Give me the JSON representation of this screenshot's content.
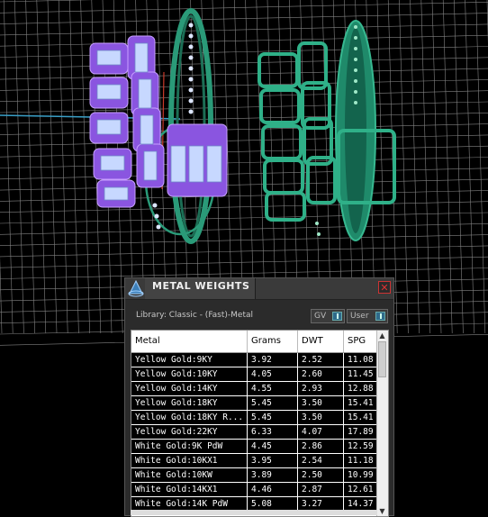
{
  "panel": {
    "title": "METAL WEIGHTS",
    "close_label": "✕",
    "library_label": "Library: Classic - (Fast)-Metal",
    "toggle_gv_label": "GV",
    "toggle_user_label": "User"
  },
  "table": {
    "columns": [
      "Metal",
      "Grams",
      "DWT",
      "SPG"
    ],
    "rows": [
      [
        "Yellow Gold:9KY",
        "3.92",
        "2.52",
        "11.08"
      ],
      [
        "Yellow Gold:10KY",
        "4.05",
        "2.60",
        "11.45"
      ],
      [
        "Yellow Gold:14KY",
        "4.55",
        "2.93",
        "12.88"
      ],
      [
        "Yellow Gold:18KY",
        "5.45",
        "3.50",
        "15.41"
      ],
      [
        "Yellow Gold:18KY R...",
        "5.45",
        "3.50",
        "15.41"
      ],
      [
        "Yellow Gold:22KY",
        "6.33",
        "4.07",
        "17.89"
      ],
      [
        "White Gold:9K PdW",
        "4.45",
        "2.86",
        "12.59"
      ],
      [
        "White Gold:10KX1",
        "3.95",
        "2.54",
        "11.18"
      ],
      [
        "White Gold:10KW",
        "3.89",
        "2.50",
        "10.99"
      ],
      [
        "White Gold:14KX1",
        "4.46",
        "2.87",
        "12.61"
      ],
      [
        "White Gold:14K PdW",
        "5.08",
        "3.27",
        "14.37"
      ]
    ]
  },
  "scene": {
    "background_color": "#000000",
    "grid_color": "#9a9a9a",
    "axis_x_color": "#3aa0c8",
    "axis_y_color": "#c83a2a",
    "ring1_stone_color": "#7a55d8",
    "ring1_metal_color": "#2a9a78",
    "ring2_metal_color": "#1f8a6a"
  }
}
